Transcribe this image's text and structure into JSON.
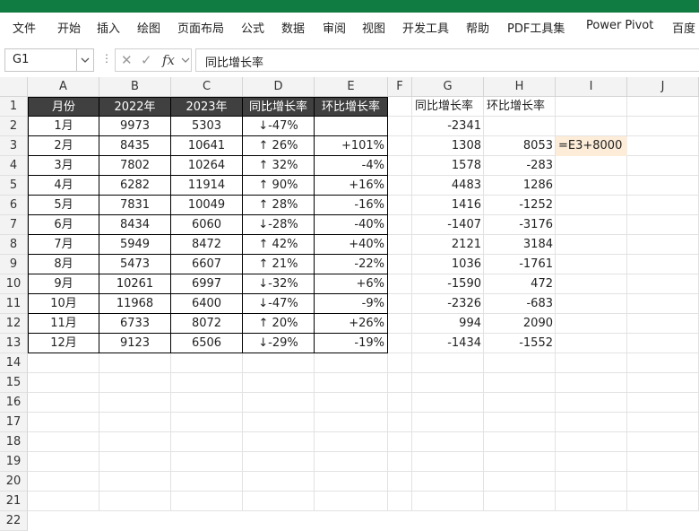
{
  "ribbon": {
    "tabs": [
      "文件",
      "开始",
      "插入",
      "绘图",
      "页面布局",
      "公式",
      "数据",
      "审阅",
      "视图",
      "开发工具",
      "帮助",
      "PDF工具集",
      "Power Pivot",
      "百度"
    ]
  },
  "formula_bar": {
    "name_box": "G1",
    "formula": "同比增长率"
  },
  "grid": {
    "columns": [
      "A",
      "B",
      "C",
      "D",
      "E",
      "F",
      "G",
      "H",
      "I",
      "J"
    ],
    "rows": [
      "1",
      "2",
      "3",
      "4",
      "5",
      "6",
      "7",
      "8",
      "9",
      "10",
      "11",
      "12",
      "13",
      "14",
      "15",
      "16",
      "17",
      "18",
      "19",
      "20",
      "21",
      "22"
    ],
    "table_header": [
      "月份",
      "2022年",
      "2023年",
      "同比增长率",
      "环比增长率"
    ],
    "table_rows": [
      [
        "1月",
        "9973",
        "5303",
        "↓-47%",
        ""
      ],
      [
        "2月",
        "8435",
        "10641",
        "↑ 26%",
        "+101%"
      ],
      [
        "3月",
        "7802",
        "10264",
        "↑ 32%",
        "-4%"
      ],
      [
        "4月",
        "6282",
        "11914",
        "↑ 90%",
        "+16%"
      ],
      [
        "5月",
        "7831",
        "10049",
        "↑ 28%",
        "-16%"
      ],
      [
        "6月",
        "8434",
        "6060",
        "↓-28%",
        "-40%"
      ],
      [
        "7月",
        "5949",
        "8472",
        "↑ 42%",
        "+40%"
      ],
      [
        "8月",
        "5473",
        "6607",
        "↑ 21%",
        "-22%"
      ],
      [
        "9月",
        "10261",
        "6997",
        "↓-32%",
        "+6%"
      ],
      [
        "10月",
        "11968",
        "6400",
        "↓-47%",
        "-9%"
      ],
      [
        "11月",
        "6733",
        "8072",
        "↑ 20%",
        "+26%"
      ],
      [
        "12月",
        "9123",
        "6506",
        "↓-29%",
        "-19%"
      ]
    ],
    "helper_header": [
      "同比增长率",
      "环比增长率"
    ],
    "helper_rows": [
      [
        "-2341",
        ""
      ],
      [
        "1308",
        "8053"
      ],
      [
        "1578",
        "-283"
      ],
      [
        "4483",
        "1286"
      ],
      [
        "1416",
        "-1252"
      ],
      [
        "-1407",
        "-3176"
      ],
      [
        "2121",
        "3184"
      ],
      [
        "1036",
        "-1761"
      ],
      [
        "-1590",
        "472"
      ],
      [
        "-2326",
        "-683"
      ],
      [
        "994",
        "2090"
      ],
      [
        "-1434",
        "-1552"
      ]
    ],
    "editing_cell": {
      "ref": "I3",
      "text": "=E3+8000"
    }
  },
  "colors": {
    "title_bar": "#107c41",
    "table_header_bg": "#404040",
    "editing_cell_bg": "#fcecd8"
  }
}
